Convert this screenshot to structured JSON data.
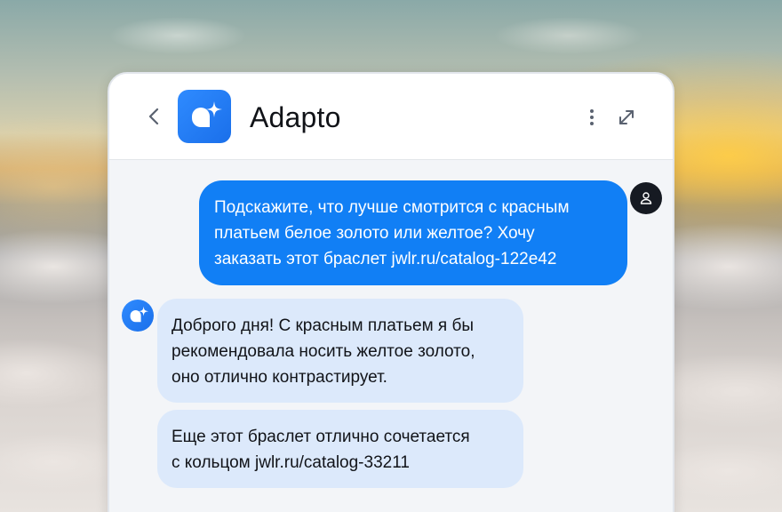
{
  "header": {
    "title": "Adapto",
    "back_icon": "chevron-left-icon",
    "logo_icon": "sparkle-logo-icon",
    "menu_icon": "more-vertical-icon",
    "expand_icon": "expand-icon"
  },
  "messages": [
    {
      "sender": "user",
      "text": "Подскажите, что лучше смотрится с красным\nплатьем белое золото или желтое? Хочу\nзаказать этот браслет jwlr.ru/catalog-122e42"
    },
    {
      "sender": "bot",
      "text": "Доброго дня! С красным платьем я бы\nрекомендовала носить желтое золото,\nоно отлично контрастирует."
    },
    {
      "sender": "bot",
      "text": "Еще этот браслет отлично сочетается\nс кольцом  jwlr.ru/catalog-33211"
    }
  ],
  "colors": {
    "accent": "#117ff5",
    "bot_bubble": "#dce9fb",
    "chat_background": "#f3f5f8",
    "user_avatar": "#161a22"
  }
}
